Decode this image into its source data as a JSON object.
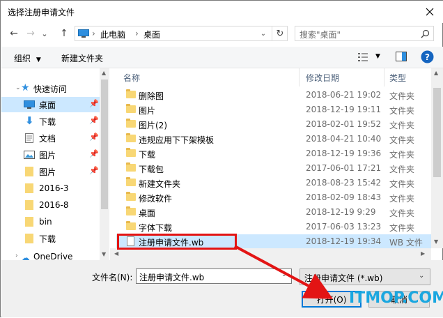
{
  "window": {
    "title": "选择注册申请文件"
  },
  "nav": {
    "back": "←",
    "forward": "→",
    "recent": "⌄",
    "up": "↑",
    "breadcrumb": [
      "此电脑",
      "桌面"
    ],
    "refresh": "↻"
  },
  "search": {
    "placeholder": "搜索\"桌面\""
  },
  "toolbar": {
    "organize": "组织",
    "new_folder": "新建文件夹"
  },
  "sidebar": {
    "items": [
      {
        "label": "快速访问"
      },
      {
        "label": "桌面"
      },
      {
        "label": "下载"
      },
      {
        "label": "文档"
      },
      {
        "label": "图片"
      },
      {
        "label": "图片"
      },
      {
        "label": "2016-3"
      },
      {
        "label": "2016-8"
      },
      {
        "label": "bin"
      },
      {
        "label": "下载"
      },
      {
        "label": "OneDrive"
      }
    ]
  },
  "columns": {
    "name": "名称",
    "date": "修改日期",
    "type": "类型"
  },
  "files": [
    {
      "name": "删除图",
      "date": "2018-06-21 19:02",
      "type": "文件夹"
    },
    {
      "name": "图片",
      "date": "2018-12-19 19:11",
      "type": "文件夹"
    },
    {
      "name": "图片(2)",
      "date": "2018-02-01 19:52",
      "type": "文件夹"
    },
    {
      "name": "违规应用下下架模板",
      "date": "2018-04-21 10:40",
      "type": "文件夹"
    },
    {
      "name": "下载",
      "date": "2018-12-19 19:36",
      "type": "文件夹"
    },
    {
      "name": "下载包",
      "date": "2017-06-01 17:21",
      "type": "文件夹"
    },
    {
      "name": "新建文件夹",
      "date": "2018-08-23 15:42",
      "type": "文件夹"
    },
    {
      "name": "修改软件",
      "date": "2018-02-09 18:43",
      "type": "文件夹"
    },
    {
      "name": "桌面",
      "date": "2018-12-19 9:29",
      "type": "文件夹"
    },
    {
      "name": "字体下载",
      "date": "2017-06-03 13:23",
      "type": "文件夹"
    },
    {
      "name": "注册申请文件.wb",
      "date": "2018-12-19 19:34",
      "type": "WB 文件"
    }
  ],
  "footer": {
    "filename_label": "文件名(N):",
    "filename_value": "注册申请文件.wb",
    "filetype_value": "注册申请文件 (*.wb)",
    "open_label": "打开(O)",
    "cancel_label": "取消"
  },
  "watermark": "ITMOP.COM",
  "colors": {
    "accent": "#0078d7",
    "selection": "#cce8ff",
    "annotation": "#e31414"
  }
}
